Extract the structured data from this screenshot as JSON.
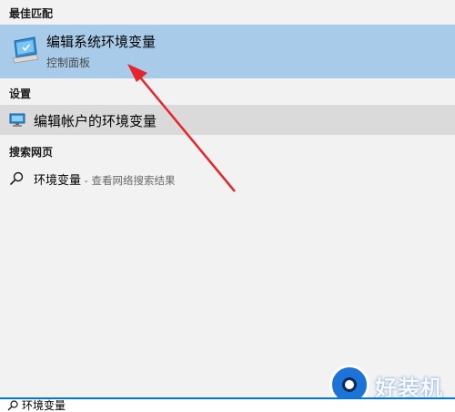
{
  "sections": {
    "best_match": "最佳匹配",
    "settings": "设置",
    "web_search": "搜索网页"
  },
  "best_match_result": {
    "title": "编辑系统环境变量",
    "subtitle": "控制面板",
    "icon": "control-panel-monitor-icon"
  },
  "settings_result": {
    "title": "编辑帐户的环境变量",
    "icon": "monitor-icon"
  },
  "web_result": {
    "query": "环境变量",
    "hint": " - 查看网络搜索结果",
    "icon": "search-icon"
  },
  "search_bar": {
    "value": "环境变量",
    "icon": "search-icon"
  },
  "watermark": {
    "text": "好装机"
  },
  "colors": {
    "selected_bg": "#a8cbe9",
    "hover_bg": "#dadada",
    "panel_bg": "#f2f2f2",
    "arrow": "#e8242b",
    "accent": "#0078d7"
  }
}
